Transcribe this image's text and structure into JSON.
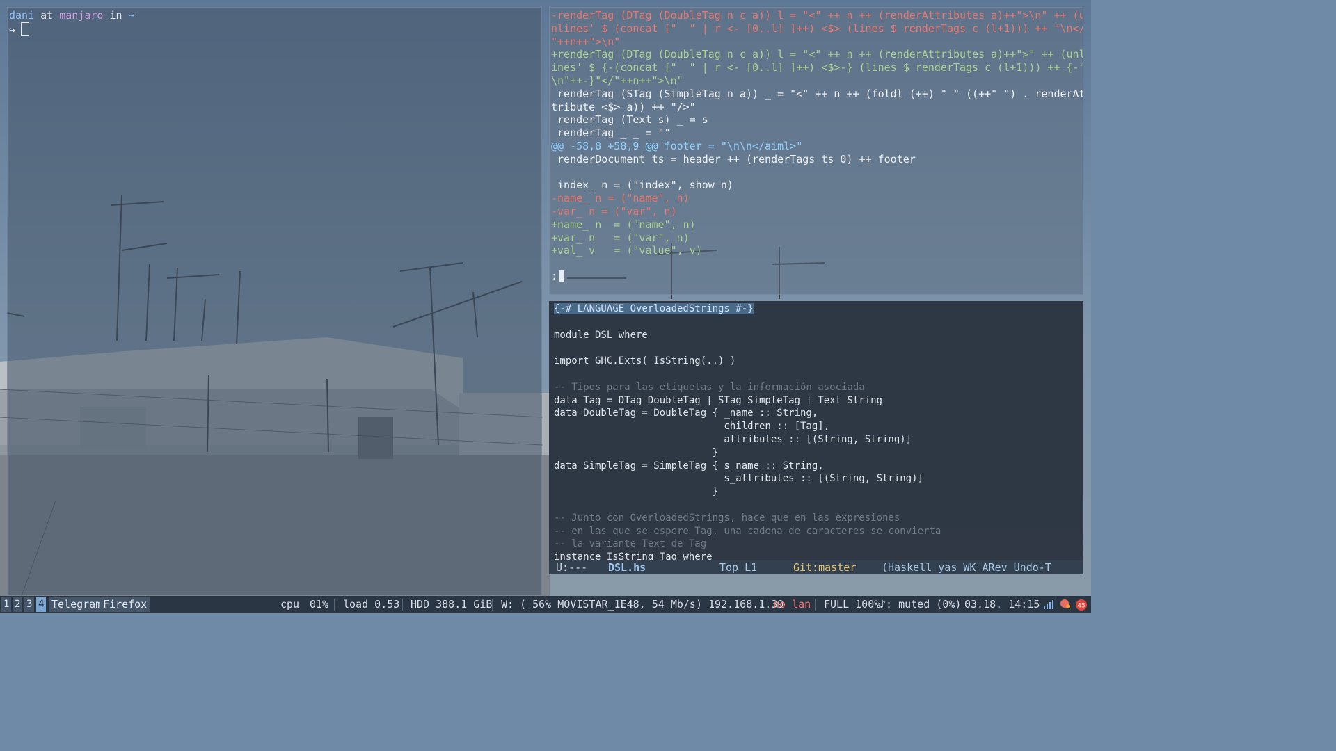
{
  "terminal": {
    "prompt_user": "dani",
    "prompt_at": " at ",
    "prompt_host": "manjaro",
    "prompt_in": " in ",
    "prompt_dir": "~",
    "prompt_arrow": "↪"
  },
  "diff": {
    "lines": [
      {
        "t": "del",
        "s": "-renderTag (DTag (DoubleTag n c a)) l = \"<\" ++ n ++ (renderAttributes a)++\">\\n\" ++ (u"
      },
      {
        "t": "del",
        "s": "nlines' $ (concat [\"  \" | r <- [0..l] ]++) <$> (lines $ renderTags c (l+1))) ++ \"\\n</"
      },
      {
        "t": "del",
        "s": "\"++n++\">\\n\""
      },
      {
        "t": "add",
        "s": "+renderTag (DTag (DoubleTag n c a)) l = \"<\" ++ n ++ (renderAttributes a)++\">\" ++ (unl"
      },
      {
        "t": "add",
        "s": "ines' $ {-(concat [\"  \" | r <- [0..l] ]++) <$>-} (lines $ renderTags c (l+1))) ++ {-\""
      },
      {
        "t": "add",
        "s": "\\n\"++-}\"</\"++n++\">\\n\""
      },
      {
        "t": "ctx",
        "s": " renderTag (STag (SimpleTag n a)) _ = \"<\" ++ n ++ (foldl (++) \" \" ((++\" \") . renderAt"
      },
      {
        "t": "ctx",
        "s": "tribute <$> a)) ++ \"/>\""
      },
      {
        "t": "ctx",
        "s": " renderTag (Text s) _ = s"
      },
      {
        "t": "ctx",
        "s": " renderTag _ _ = \"\""
      },
      {
        "t": "hunk",
        "s": "@@ -58,8 +58,9 @@ footer = \"\\n\\n</aiml>\""
      },
      {
        "t": "ctx",
        "s": " renderDocument ts = header ++ (renderTags ts 0) ++ footer"
      },
      {
        "t": "ctx",
        "s": ""
      },
      {
        "t": "ctx",
        "s": " index_ n = (\"index\", show n)"
      },
      {
        "t": "del",
        "s": "-name_ n = (\"name\", n)"
      },
      {
        "t": "del",
        "s": "-var_ n = (\"var\", n)"
      },
      {
        "t": "add",
        "s": "+name_ n  = (\"name\", n)"
      },
      {
        "t": "add",
        "s": "+var_ n   = (\"var\", n)"
      },
      {
        "t": "add",
        "s": "+val_ v   = (\"value\", v)"
      }
    ],
    "prompt": ":"
  },
  "editor": {
    "lines": [
      {
        "s": "{-# LANGUAGE OverloadedStrings #-}",
        "c": "pragma"
      },
      {
        "s": "",
        "c": "code"
      },
      {
        "s": "module DSL where",
        "c": "code"
      },
      {
        "s": "",
        "c": "code"
      },
      {
        "s": "import GHC.Exts( IsString(..) )",
        "c": "code"
      },
      {
        "s": "",
        "c": "code"
      },
      {
        "s": "-- Tipos para las etiquetas y la información asociada",
        "c": "cmt"
      },
      {
        "s": "data Tag = DTag DoubleTag | STag SimpleTag | Text String",
        "c": "code"
      },
      {
        "s": "data DoubleTag = DoubleTag { _name :: String,",
        "c": "code"
      },
      {
        "s": "                             children :: [Tag],",
        "c": "code"
      },
      {
        "s": "                             attributes :: [(String, String)]",
        "c": "code"
      },
      {
        "s": "                           }",
        "c": "code"
      },
      {
        "s": "data SimpleTag = SimpleTag { s_name :: String,",
        "c": "code"
      },
      {
        "s": "                             s_attributes :: [(String, String)]",
        "c": "code"
      },
      {
        "s": "                           }",
        "c": "code"
      },
      {
        "s": "",
        "c": "code"
      },
      {
        "s": "-- Junto con OverloadedStrings, hace que en las expresiones",
        "c": "cmt"
      },
      {
        "s": "-- en las que se espere Tag, una cadena de caracteres se convierta",
        "c": "cmt"
      },
      {
        "s": "-- la variante Text de Tag",
        "c": "cmt"
      },
      {
        "s": "instance IsString Tag where",
        "c": "code"
      }
    ],
    "modeline": {
      "state": "U:---",
      "buffer": "DSL.hs",
      "position": "Top L1",
      "vc": "Git:master",
      "modes": "(Haskell yas WK ARev Undo-T"
    }
  },
  "bar": {
    "workspaces": [
      "1",
      "2",
      "3",
      "4"
    ],
    "active_workspace": "4",
    "apps": [
      "Telegram",
      "Firefox"
    ],
    "cpu_label": "cpu",
    "cpu_value": "01%",
    "load": "load 0.53",
    "hdd": "HDD 388.1 GiB",
    "wifi": "W: ( 56% MOVISTAR_1E48, 54 Mb/s) 192.168.1.39",
    "lan": "no lan",
    "battery": "FULL 100%",
    "volume": "♪: muted (0%)",
    "clock": "03.18. 14:15",
    "colors": {
      "accent": "#79a6d2",
      "bar_bg": "#2b3645",
      "alert": "#ff7b73"
    }
  }
}
